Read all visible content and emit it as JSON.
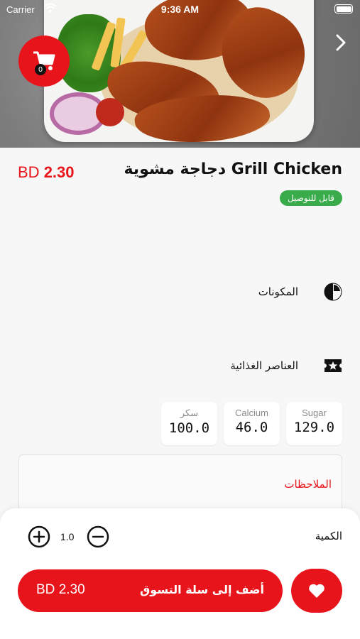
{
  "status_bar": {
    "carrier": "Carrier",
    "time": "9:36 AM"
  },
  "cart": {
    "count": "0"
  },
  "product": {
    "price": "2.30",
    "currency": "BD",
    "title": "Grill Chicken دجاجة مشوية",
    "delivery_badge": "قابل للتوصيل"
  },
  "sections": {
    "ingredients_label": "المكونات",
    "nutrients_label": "العناصر الغذائية"
  },
  "nutrition": [
    {
      "label": "Sugar",
      "value": "129.0"
    },
    {
      "label": "Calcium",
      "value": "46.0"
    },
    {
      "label": "سكر",
      "value": "100.0"
    }
  ],
  "notes": {
    "label": "الملاحظات"
  },
  "quantity": {
    "label": "الكمية",
    "value": "1.0"
  },
  "add_to_cart": {
    "label": "أضف إلى سلة التسوق",
    "price": "2.30",
    "currency": "BD"
  },
  "colors": {
    "accent": "#e8141c",
    "badge": "#3aab4a"
  }
}
